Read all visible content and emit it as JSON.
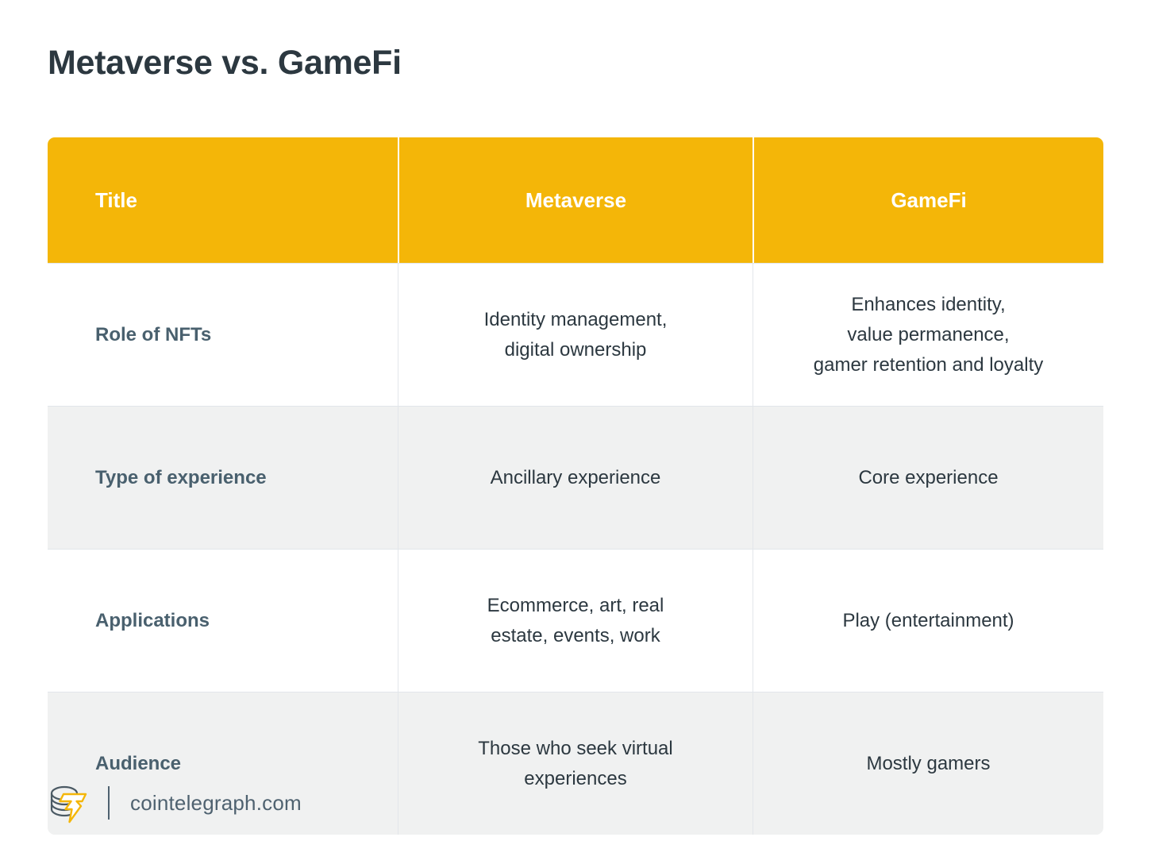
{
  "page": {
    "title": "Metaverse vs. GameFi",
    "background_color": "#ffffff"
  },
  "colors": {
    "header_yellow": "#F4B608",
    "title_dark": "#2c3840",
    "label_slate": "#49606e",
    "row_alt_gray": "#f0f1f1",
    "divider_gray": "#e2e6ea",
    "footer_text": "#4f6270",
    "logo_yellow": "#F4B608",
    "logo_outline": "#4b5a64"
  },
  "table": {
    "columns": [
      {
        "key": "title",
        "label": "Title"
      },
      {
        "key": "metaverse",
        "label": "Metaverse"
      },
      {
        "key": "gamefi",
        "label": "GameFi"
      }
    ],
    "rows": [
      {
        "title": "Role of NFTs",
        "metaverse": "Identity management,\ndigital ownership",
        "gamefi": "Enhances identity,\nvalue permanence,\ngamer retention and loyalty",
        "shaded": false
      },
      {
        "title": "Type of experience",
        "metaverse": "Ancillary experience",
        "gamefi": "Core experience",
        "shaded": true
      },
      {
        "title": "Applications",
        "metaverse": "Ecommerce, art, real\nestate, events, work",
        "gamefi": "Play (entertainment)",
        "shaded": false
      },
      {
        "title": "Audience",
        "metaverse": "Those who seek virtual\nexperiences",
        "gamefi": "Mostly gamers",
        "shaded": true
      }
    ]
  },
  "footer": {
    "logo_name": "cointelegraph-coins-bolt-logo",
    "site": "cointelegraph.com"
  }
}
